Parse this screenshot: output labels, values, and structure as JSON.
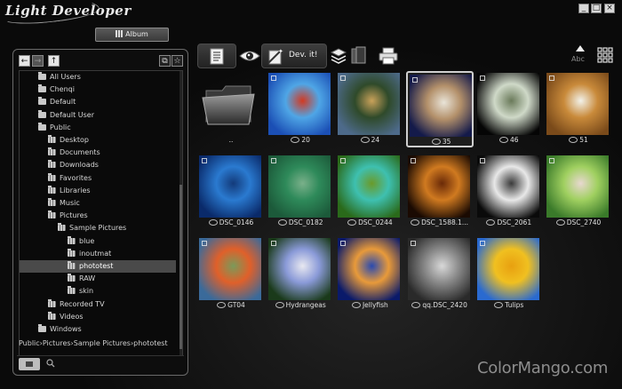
{
  "window": {
    "app_title": "Light Developer",
    "min_label": "_",
    "max_label": "□",
    "close_label": "×"
  },
  "album_tab": {
    "label": "Album"
  },
  "left_panel": {
    "nav": {
      "back": "←",
      "forward": "→",
      "up": "↑"
    },
    "tree": [
      {
        "label": "All Users",
        "indent": 1
      },
      {
        "label": "Chenqi",
        "indent": 1
      },
      {
        "label": "Default",
        "indent": 1
      },
      {
        "label": "Default User",
        "indent": 1
      },
      {
        "label": "Public",
        "indent": 1
      },
      {
        "label": "Desktop",
        "indent": 2
      },
      {
        "label": "Documents",
        "indent": 2
      },
      {
        "label": "Downloads",
        "indent": 2
      },
      {
        "label": "Favorites",
        "indent": 2
      },
      {
        "label": "Libraries",
        "indent": 2
      },
      {
        "label": "Music",
        "indent": 2
      },
      {
        "label": "Pictures",
        "indent": 2
      },
      {
        "label": "Sample Pictures",
        "indent": 3
      },
      {
        "label": "blue",
        "indent": 4
      },
      {
        "label": "inoutmat",
        "indent": 4
      },
      {
        "label": "phototest",
        "indent": 4
      },
      {
        "label": "RAW",
        "indent": 4
      },
      {
        "label": "skin",
        "indent": 4
      },
      {
        "label": "Recorded TV",
        "indent": 2
      },
      {
        "label": "Videos",
        "indent": 2
      },
      {
        "label": "Windows",
        "indent": 1
      }
    ],
    "selected": "phototest",
    "breadcrumb": "Public›Pictures›Sample Pictures›phototest"
  },
  "toolbar": {
    "dev_it_label": "Dev. it!",
    "sort_label": "Abc"
  },
  "thumbnails": [
    {
      "caption": "..",
      "kind": "folder"
    },
    {
      "caption": "20",
      "raw": true,
      "colors": [
        "#1b4fb5",
        "#4fa6e6",
        "#d23a22"
      ]
    },
    {
      "caption": "24",
      "raw": true,
      "colors": [
        "#4d6a8a",
        "#2f4a2a",
        "#c9a25a"
      ]
    },
    {
      "caption": "35",
      "raw": true,
      "selected": true,
      "colors": [
        "#141a4a",
        "#b3906a",
        "#e9e4d8"
      ]
    },
    {
      "caption": "46",
      "raw": true,
      "colors": [
        "#050505",
        "#cfd9c8",
        "#6a7a5a"
      ]
    },
    {
      "caption": "51",
      "raw": true,
      "colors": [
        "#7a4a1a",
        "#c98a3a",
        "#f2f2ea"
      ]
    },
    {
      "caption": "DSC_0146",
      "raw": true,
      "colors": [
        "#0a2a6a",
        "#2a7ad0",
        "#133a7a"
      ]
    },
    {
      "caption": "DSC_0182",
      "raw": true,
      "colors": [
        "#1c5a3a",
        "#2e8a5a",
        "#7ab08a"
      ]
    },
    {
      "caption": "DSC_0244",
      "raw": true,
      "colors": [
        "#2a6a1a",
        "#3ec0b0",
        "#6a9a2a"
      ]
    },
    {
      "caption": "DSC_1588.1...",
      "raw": true,
      "colors": [
        "#1a0a02",
        "#d07a20",
        "#6a2a08"
      ]
    },
    {
      "caption": "DSC_2061",
      "raw": true,
      "colors": [
        "#0a0a0a",
        "#e8e8e8",
        "#3a3a3a"
      ]
    },
    {
      "caption": "DSC_2740",
      "raw": true,
      "colors": [
        "#3a7a2a",
        "#a0d060",
        "#e8d8d0"
      ]
    },
    {
      "caption": "GT04",
      "raw": true,
      "colors": [
        "#3a6a9a",
        "#e0602a",
        "#7a9a5a"
      ]
    },
    {
      "caption": "Hydrangeas",
      "raw": true,
      "colors": [
        "#1a3a1a",
        "#8a9ad8",
        "#e8e8f0"
      ]
    },
    {
      "caption": "Jellyfish",
      "raw": true,
      "colors": [
        "#0a1a6a",
        "#e89a3a",
        "#2a4ab0"
      ]
    },
    {
      "caption": "qq.DSC_2420",
      "raw": true,
      "colors": [
        "#2a2a2a",
        "#8a8a8a",
        "#d8d8d8"
      ]
    },
    {
      "caption": "Tulips",
      "raw": true,
      "colors": [
        "#2a6ad0",
        "#f0c020",
        "#e8a010"
      ]
    }
  ],
  "watermark": "ColorMango.com"
}
